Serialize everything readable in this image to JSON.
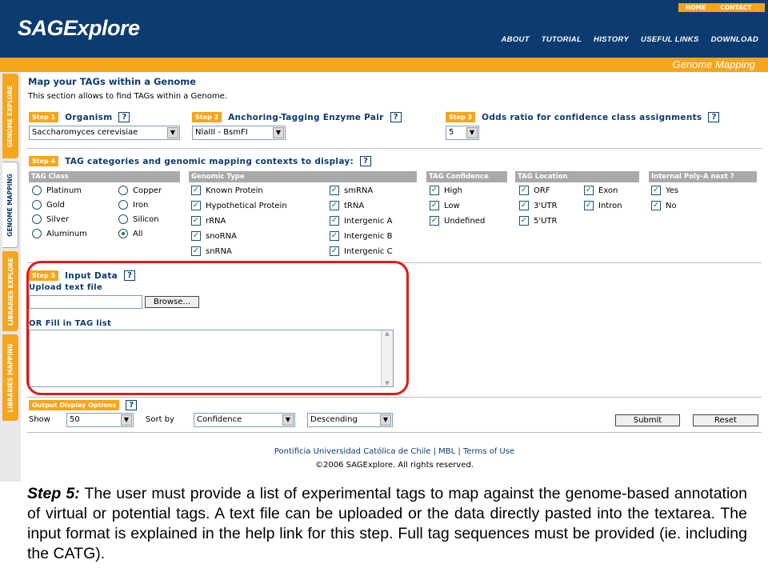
{
  "header": {
    "logo": "SAGExplore",
    "top_links": [
      "HOME",
      "CONTACT"
    ],
    "nav": [
      "ABOUT",
      "TUTORIAL",
      "HISTORY",
      "USEFUL LINKS",
      "DOWNLOAD"
    ],
    "section": "Genome Mapping"
  },
  "sidebar": {
    "tabs": [
      "GENOME EXPLORE",
      "GENOME MAPPING",
      "LIBRARIES EXPLORE",
      "LIBRARIES MAPPING"
    ],
    "active": "GENOME MAPPING"
  },
  "page": {
    "title": "Map your TAGs within a Genome",
    "description": "This section allows to find TAGs within a Genome."
  },
  "step1": {
    "tag": "Step 1",
    "label": "Organism",
    "value": "Saccharomyces cerevisiae"
  },
  "step2": {
    "tag": "Step 2",
    "label": "Anchoring-Tagging Enzyme Pair",
    "value": "NlaIII - BsmFI"
  },
  "step3": {
    "tag": "Step 3",
    "label": "Odds ratio for confidence class assignments",
    "value": "5"
  },
  "step4": {
    "tag": "Step 4",
    "label": "TAG categories and genomic mapping contexts to display:",
    "tag_class": {
      "header": "TAG Class",
      "options": [
        "Platinum",
        "Copper",
        "Gold",
        "Iron",
        "Silver",
        "Silicon",
        "Aluminum",
        "All"
      ],
      "selected": "All"
    },
    "genomic_type": {
      "header": "Genomic Type",
      "options": [
        "Known Protein",
        "smRNA",
        "Hypothetical Protein",
        "tRNA",
        "rRNA",
        "Intergenic A",
        "snoRNA",
        "Intergenic B",
        "snRNA",
        "Intergenic C"
      ]
    },
    "confidence": {
      "header": "TAG Confidence",
      "options": [
        "High",
        "Low",
        "Undefined"
      ]
    },
    "location": {
      "header": "TAG Location",
      "options": [
        "ORF",
        "Exon",
        "3'UTR",
        "Intron",
        "5'UTR"
      ]
    },
    "polya": {
      "header": "Internal Poly-A next ?",
      "options": [
        "Yes",
        "No"
      ]
    }
  },
  "step5": {
    "tag": "Step 5",
    "label": "Input Data",
    "upload_label": "Upload text file",
    "browse": "Browse...",
    "fill_label": "OR Fill in TAG list"
  },
  "output": {
    "tag": "Output Display Options",
    "show_label": "Show",
    "show_value": "50",
    "sort_label": "Sort by",
    "sort_value": "Confidence",
    "order_value": "Descending",
    "submit": "Submit",
    "reset": "Reset"
  },
  "footer": {
    "links": [
      "Pontificia Universidad Católica de Chile",
      "MBL",
      "Terms of Use"
    ],
    "copyright": "©2006 SAGExplore. All rights reserved."
  },
  "caption": {
    "lead": "Step 5:",
    "text": " The user must provide a list of experimental tags to map against the genome-based annotation of virtual or potential tags. A text file can be uploaded or the data directly pasted into the textarea. The input format is explained in the help link for this step. Full tag sequences must be provided (ie. including the CATG)."
  },
  "colors": {
    "navy": "#0c3b70",
    "orange": "#f7a51c",
    "highlight": "#e21a1a"
  }
}
